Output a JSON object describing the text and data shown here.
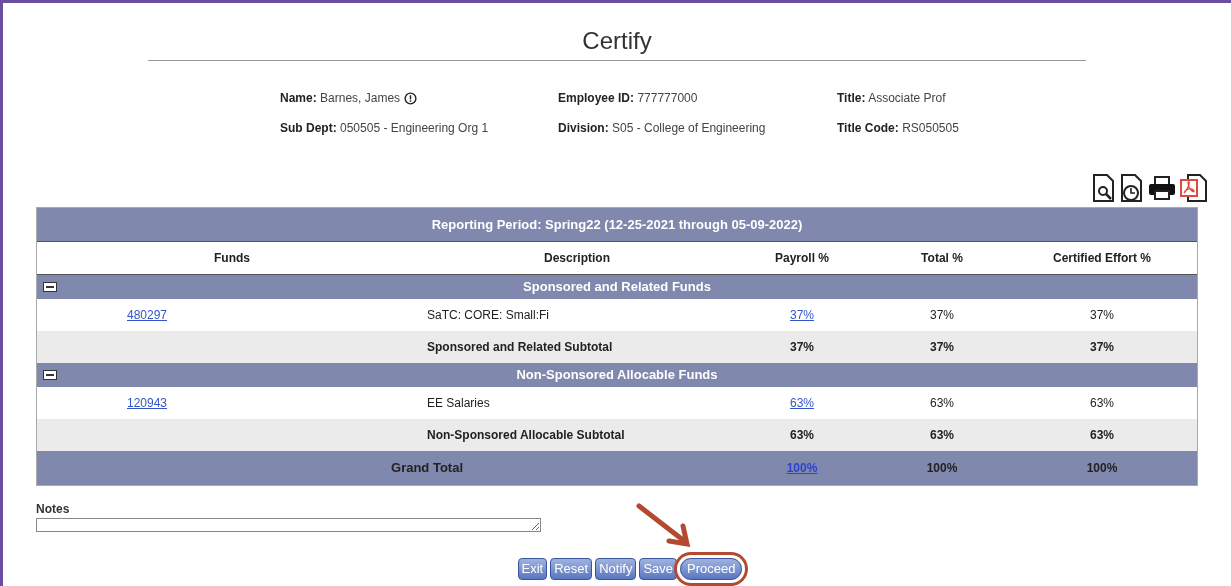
{
  "title": "Certify",
  "info": [
    {
      "label": "Name:",
      "value": "Barnes, James",
      "info_icon": true
    },
    {
      "label": "Employee ID:",
      "value": "777777000",
      "info_icon": false
    },
    {
      "label": "Title:",
      "value": "Associate Prof",
      "info_icon": false
    },
    {
      "label": "Sub Dept:",
      "value": "050505 - Engineering Org 1",
      "info_icon": false
    },
    {
      "label": "Division:",
      "value": "S05 - College of Engineering",
      "info_icon": false
    },
    {
      "label": "Title Code:",
      "value": "RS050505",
      "info_icon": false
    }
  ],
  "table": {
    "period": "Reporting Period: Spring22 (12-25-2021 through 05-09-2022)",
    "columns": [
      "Funds",
      "Description",
      "Payroll %",
      "Total %",
      "Certified Effort %"
    ],
    "groups": [
      {
        "title": "Sponsored and Related Funds",
        "expanded": true,
        "rows": [
          {
            "fund": "480297",
            "description": "SaTC: CORE: Small:Fi",
            "payroll": "37%",
            "total": "37%",
            "certified": "37%"
          }
        ],
        "subtotal": {
          "label": "Sponsored and Related Subtotal",
          "payroll": "37%",
          "total": "37%",
          "certified": "37%"
        }
      },
      {
        "title": "Non-Sponsored Allocable Funds",
        "expanded": true,
        "rows": [
          {
            "fund": "120943",
            "description": "EE Salaries",
            "payroll": "63%",
            "total": "63%",
            "certified": "63%"
          }
        ],
        "subtotal": {
          "label": "Non-Sponsored Allocable Subtotal",
          "payroll": "63%",
          "total": "63%",
          "certified": "63%"
        }
      }
    ],
    "grand_total": {
      "label": "Grand Total",
      "payroll": "100%",
      "total": "100%",
      "certified": "100%"
    }
  },
  "notes": {
    "label": "Notes"
  },
  "buttons": [
    {
      "label": "Exit",
      "highlighted": false
    },
    {
      "label": "Reset",
      "highlighted": false
    },
    {
      "label": "Notify",
      "highlighted": false
    },
    {
      "label": "Save",
      "highlighted": false
    },
    {
      "label": "Proceed",
      "highlighted": true
    }
  ]
}
